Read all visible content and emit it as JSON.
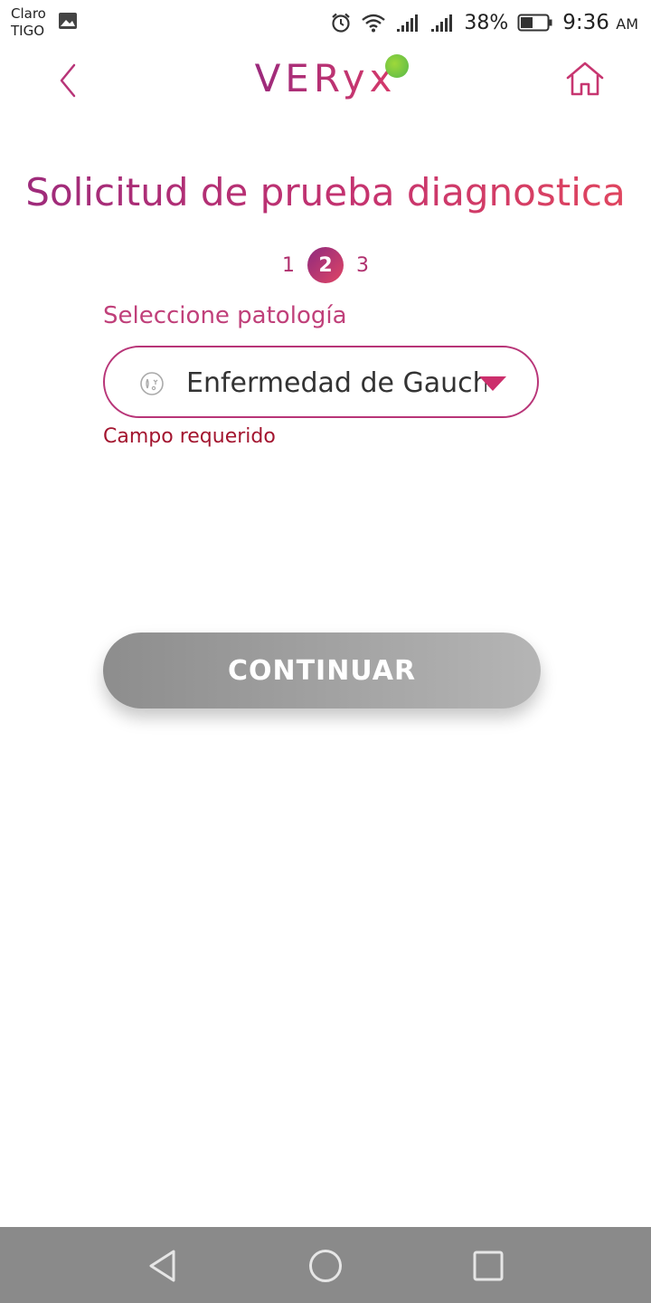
{
  "status_bar": {
    "carrier_line1": "Claro",
    "carrier_line2": "TIGO",
    "battery": "38%",
    "time": "9:36",
    "ampm": "AM",
    "icons": [
      "gallery-icon",
      "alarm-icon",
      "wifi-icon",
      "signal-icon",
      "signal-icon",
      "battery-icon"
    ]
  },
  "header": {
    "logo": "VERyx",
    "back_icon": "chevron-left-icon",
    "home_icon": "home-icon"
  },
  "page": {
    "title": "Solicitud de prueba diagnostica",
    "steps": [
      "1",
      "2",
      "3"
    ],
    "active_step": "2"
  },
  "form": {
    "label": "Seleccione patología",
    "selected_value": "Enfermedad de Gaucher",
    "error": "Campo requerido"
  },
  "actions": {
    "continue_label": "CONTINUAR"
  },
  "nav_bar": {
    "icons": [
      "back-triangle-icon",
      "home-circle-icon",
      "recents-square-icon"
    ]
  },
  "colors": {
    "brand_start": "#9b2a7c",
    "brand_end": "#e2475d",
    "error": "#a3152f",
    "button_disabled": "#9e9e9e",
    "logo_dot": "#6cc24a"
  }
}
